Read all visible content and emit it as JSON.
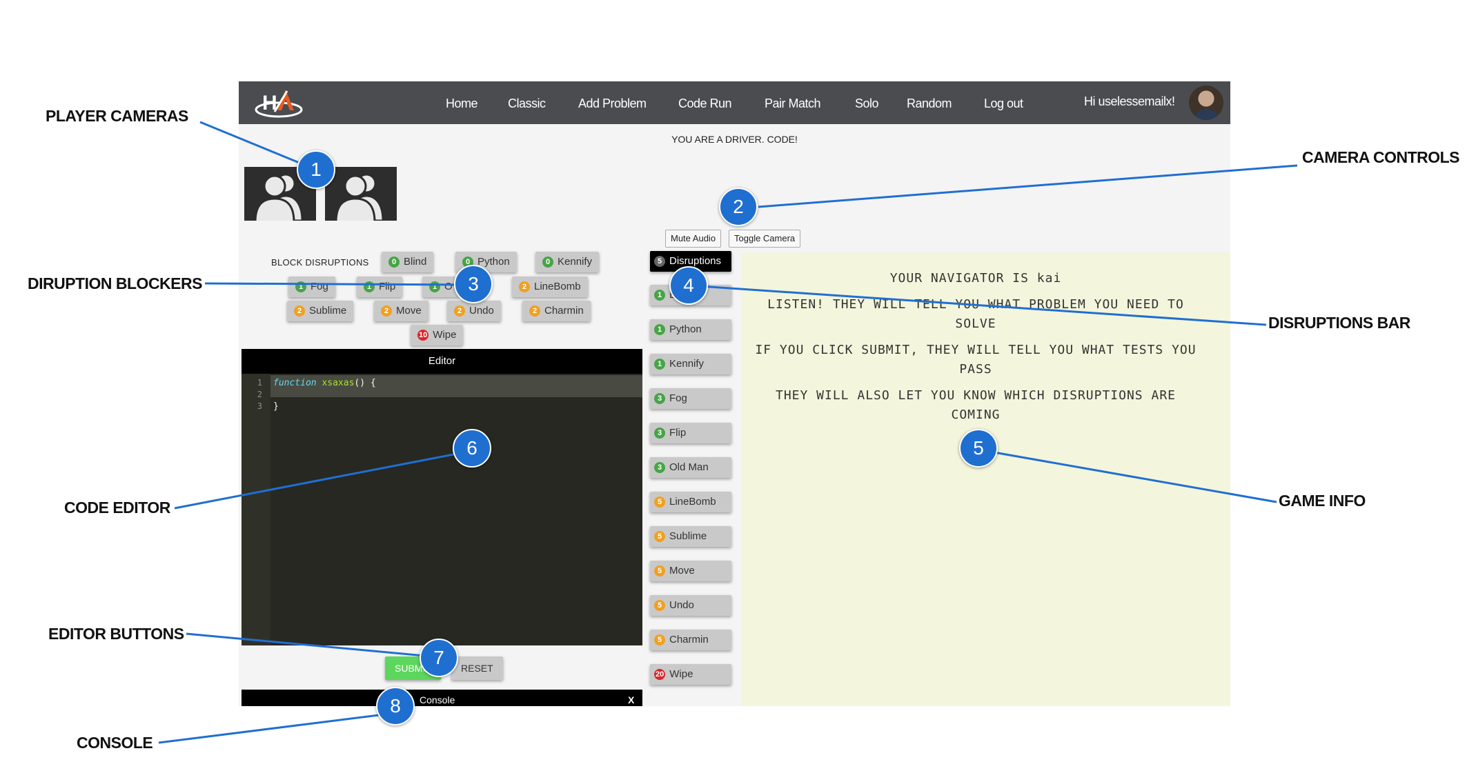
{
  "callouts": {
    "player_cameras": "PLAYER CAMERAS",
    "camera_controls": "CAMERA CONTROLS",
    "disruption_blockers": "DIRUPTION BLOCKERS",
    "disruptions_bar": "DISRUPTIONS BAR",
    "game_info": "GAME INFO",
    "code_editor": "CODE EDITOR",
    "editor_buttons": "EDITOR BUTTONS",
    "console": "CONSOLE"
  },
  "markers": [
    "1",
    "2",
    "3",
    "4",
    "5",
    "6",
    "7",
    "8"
  ],
  "nav": {
    "logo_icon": "hacker-arena-logo",
    "items": [
      "Home",
      "Classic",
      "Add Problem",
      "Code Run",
      "Pair Match",
      "Solo",
      "Random",
      "Log out"
    ],
    "greeting": "Hi uselessemailx!",
    "avatar_icon": "user-avatar"
  },
  "status": {
    "message": "YOU ARE A DRIVER. CODE!"
  },
  "cameras": {
    "icon": "users-icon",
    "count": 2
  },
  "camera_controls": {
    "mute": "Mute Audio",
    "toggle": "Toggle Camera"
  },
  "block_disruptions": {
    "label": "BLOCK DISRUPTIONS",
    "items": [
      {
        "count": "0",
        "name": "Blind",
        "color": "green"
      },
      {
        "count": "0",
        "name": "Python",
        "color": "green"
      },
      {
        "count": "0",
        "name": "Kennify",
        "color": "green"
      },
      {
        "count": "1",
        "name": "Fog",
        "color": "green"
      },
      {
        "count": "1",
        "name": "Flip",
        "color": "green"
      },
      {
        "count": "1",
        "name": "O",
        "color": "green"
      },
      {
        "count": "2",
        "name": "LineBomb",
        "color": "orange"
      },
      {
        "count": "2",
        "name": "Sublime",
        "color": "orange"
      },
      {
        "count": "2",
        "name": "Move",
        "color": "orange"
      },
      {
        "count": "2",
        "name": "Undo",
        "color": "orange"
      },
      {
        "count": "2",
        "name": "Charmin",
        "color": "orange"
      },
      {
        "count": "10",
        "name": "Wipe",
        "color": "red"
      }
    ]
  },
  "editor": {
    "title": "Editor",
    "line_numbers": [
      "1",
      "2",
      "3"
    ],
    "code": {
      "keyword": "function",
      "fname": "xsaxas",
      "rest": "() {",
      "close": "}"
    },
    "submit_label": "SUBMIT",
    "reset_label": "RESET"
  },
  "console": {
    "title": "Console",
    "close": "X"
  },
  "disruptions_bar": {
    "header": {
      "count": "5",
      "name": "Disruptions"
    },
    "items": [
      {
        "count": "1",
        "name": "Blind",
        "color": "green"
      },
      {
        "count": "1",
        "name": "Python",
        "color": "green"
      },
      {
        "count": "1",
        "name": "Kennify",
        "color": "green"
      },
      {
        "count": "3",
        "name": "Fog",
        "color": "green"
      },
      {
        "count": "3",
        "name": "Flip",
        "color": "green"
      },
      {
        "count": "3",
        "name": "Old Man",
        "color": "green"
      },
      {
        "count": "5",
        "name": "LineBomb",
        "color": "orange"
      },
      {
        "count": "5",
        "name": "Sublime",
        "color": "orange"
      },
      {
        "count": "5",
        "name": "Move",
        "color": "orange"
      },
      {
        "count": "5",
        "name": "Undo",
        "color": "orange"
      },
      {
        "count": "5",
        "name": "Charmin",
        "color": "orange"
      },
      {
        "count": "20",
        "name": "Wipe",
        "color": "red"
      }
    ]
  },
  "game_info": {
    "lines": [
      "YOUR NAVIGATOR IS kai",
      "LISTEN! THEY WILL TELL YOU WHAT PROBLEM YOU NEED TO",
      "SOLVE",
      "IF YOU CLICK SUBMIT, THEY WILL TELL YOU WHAT TESTS YOU",
      "PASS",
      "THEY WILL ALSO LET YOU KNOW WHICH DISRUPTIONS ARE",
      "COMING"
    ]
  },
  "colors": {
    "navbar": "#4a4c50",
    "marker": "#1f6fd1",
    "editor_bg": "#272822",
    "game_info_bg": "#f3f5dc",
    "submit": "#5cd65c",
    "badge_green": "#47a447",
    "badge_orange": "#f0a020",
    "badge_red": "#d9262b"
  }
}
